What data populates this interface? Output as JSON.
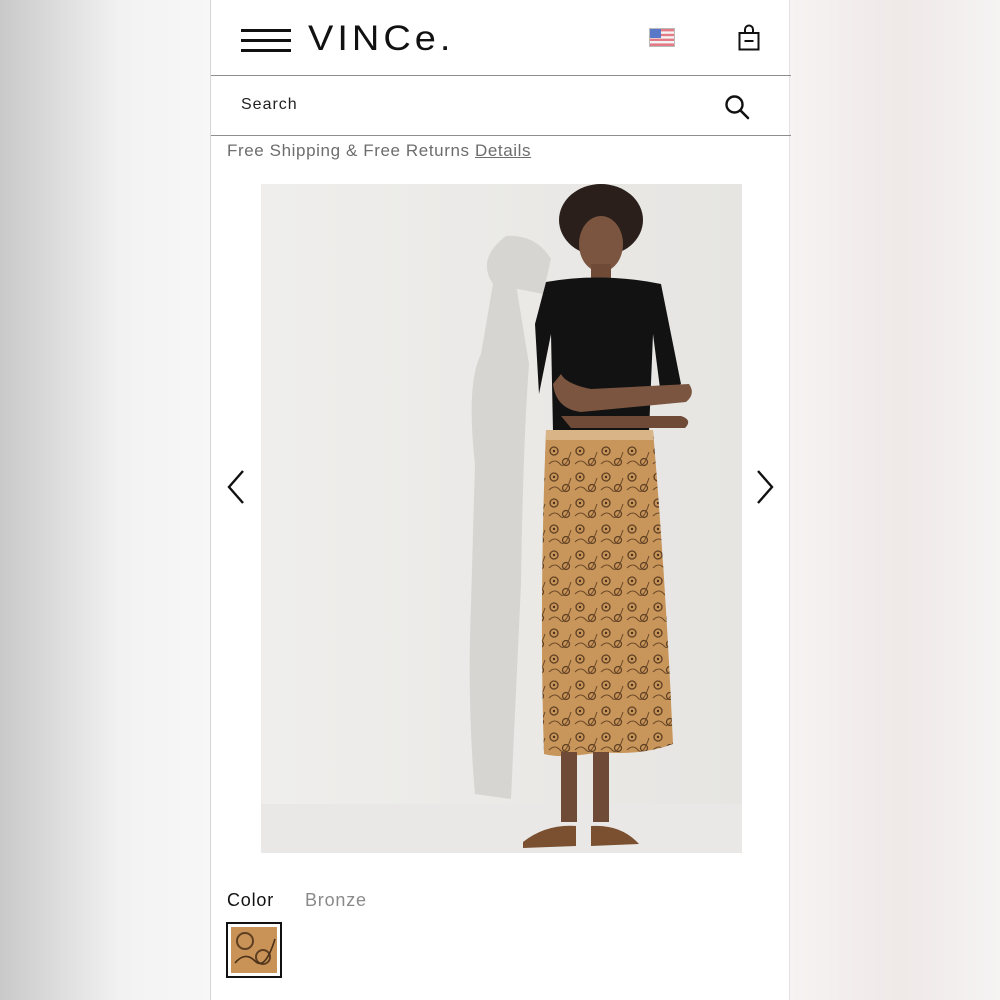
{
  "header": {
    "logo_text": "VINCe.",
    "flag_icon": "us-flag-icon",
    "bag_icon": "shopping-bag-icon",
    "menu_icon": "hamburger-menu-icon"
  },
  "search": {
    "placeholder": "Search",
    "icon": "search-icon"
  },
  "banner": {
    "text": "Free Shipping & Free Returns",
    "link_label": "Details"
  },
  "gallery": {
    "prev_icon": "chevron-left-icon",
    "next_icon": "chevron-right-icon",
    "image_alt": "Model wearing black short-sleeve knit top and bronze lace midi skirt with strappy sandals"
  },
  "product": {
    "color_label": "Color",
    "color_value": "Bronze"
  },
  "colors": {
    "brand_text": "#111111",
    "muted_text": "#6d6d6d",
    "swatch_bronze": "#c99358"
  }
}
